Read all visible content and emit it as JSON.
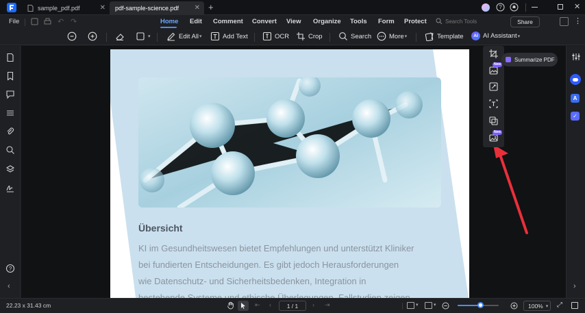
{
  "tabs": [
    {
      "label": "sample_pdf.pdf",
      "active": false
    },
    {
      "label": "pdf-sample-science.pdf",
      "active": true
    }
  ],
  "new_tab_symbol": "+",
  "window_controls": [
    "avatar",
    "help-icon",
    "bell-icon",
    "minimize-icon",
    "maximize-icon",
    "close-icon"
  ],
  "menu": {
    "file": "File",
    "items": [
      "Home",
      "Edit",
      "Comment",
      "Convert",
      "View",
      "Organize",
      "Tools",
      "Form",
      "Protect"
    ],
    "active": "Home",
    "search_placeholder": "Search Tools",
    "share": "Share"
  },
  "toolbar": {
    "edit_all": "Edit All",
    "add_text": "Add Text",
    "ocr": "OCR",
    "crop": "Crop",
    "search": "Search",
    "more": "More",
    "template": "Template",
    "ai_assistant": "AI Assistant",
    "ai_badge": "AI"
  },
  "floating": {
    "new_badge": "New",
    "summarize": "Summarize PDF"
  },
  "document": {
    "heading": "Übersicht",
    "lines": [
      "KI im Gesundheitswesen bietet Empfehlungen und unterstützt Kliniker",
      "bei fundierten Entscheidungen.   Es gibt jedoch Herausforderungen",
      "wie Datenschutz- und Sicherheitsbedenken, Integration in",
      "bestehende Systeme und ethische Überlegungen. Fallstudien zeigen"
    ]
  },
  "status": {
    "dimensions": "22.23 x 31.43 cm",
    "page": "1 / 1",
    "zoom": "100%",
    "zoom_level": 0.55
  },
  "colors": {
    "accent": "#4a8df8",
    "selection_fill": "#a9cde4",
    "arrow": "#e8303a",
    "badge": "#7b5cff"
  }
}
